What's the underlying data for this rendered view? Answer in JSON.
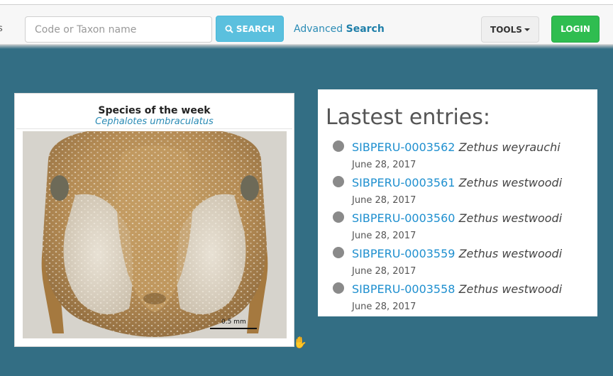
{
  "navbar": {
    "search_placeholder": "Code or Taxon name",
    "search_label": "SEARCH",
    "advanced_prefix": "Advanced",
    "advanced_suffix": "Search",
    "tools_label": "TOOLS",
    "login_label": "LOGIN"
  },
  "species": {
    "title": "Species of the week",
    "name": "Cephalotes umbraculatus",
    "scale_label": "0.5 mm"
  },
  "entries": {
    "title": "Lastest entries:",
    "items": [
      {
        "code": "SIBPERU-0003562",
        "species": "Zethus weyrauchi",
        "date": "June 28, 2017"
      },
      {
        "code": "SIBPERU-0003561",
        "species": "Zethus westwoodi",
        "date": "June 28, 2017"
      },
      {
        "code": "SIBPERU-0003560",
        "species": "Zethus westwoodi",
        "date": "June 28, 2017"
      },
      {
        "code": "SIBPERU-0003559",
        "species": "Zethus westwoodi",
        "date": "June 28, 2017"
      },
      {
        "code": "SIBPERU-0003558",
        "species": "Zethus westwoodi",
        "date": "June 28, 2017"
      }
    ]
  },
  "colors": {
    "background": "#336e84",
    "search_button": "#5bc0de",
    "login_button": "#2fbd50",
    "link": "#1e8fcf"
  }
}
